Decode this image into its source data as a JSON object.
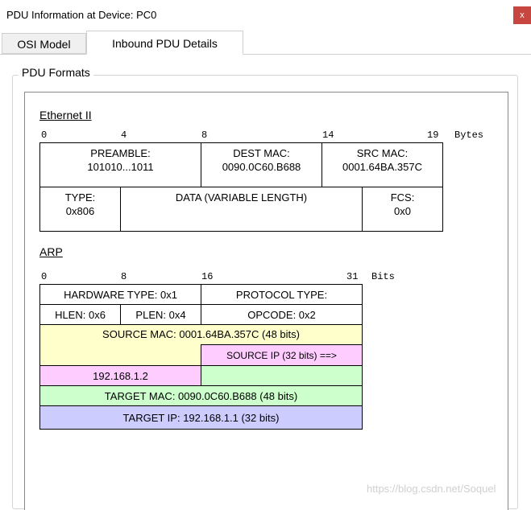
{
  "window": {
    "title": "PDU Information at Device: PC0",
    "close_label": "x"
  },
  "tabs": [
    {
      "label": "OSI Model"
    },
    {
      "label": "Inbound PDU Details"
    }
  ],
  "group": {
    "label": "PDU Formats"
  },
  "ethernet": {
    "title": "Ethernet II",
    "ruler": [
      "0",
      "4",
      "8",
      "14",
      "19",
      "Bytes"
    ],
    "preamble": {
      "label": "PREAMBLE:",
      "value": "101010...1011"
    },
    "dest_mac": {
      "label": "DEST MAC:",
      "value": "0090.0C60.B688"
    },
    "src_mac": {
      "label": "SRC MAC:",
      "value": "0001.64BA.357C"
    },
    "type": {
      "label": "TYPE:",
      "value": "0x806"
    },
    "data": {
      "label": "DATA (VARIABLE LENGTH)"
    },
    "fcs": {
      "label": "FCS:",
      "value": "0x0"
    }
  },
  "arp": {
    "title": "ARP",
    "ruler": [
      "0",
      "8",
      "16",
      "31",
      "Bits"
    ],
    "hardware_type": "HARDWARE TYPE: 0x1",
    "protocol_type": "PROTOCOL TYPE:",
    "hlen": "HLEN: 0x6",
    "plen": "PLEN: 0x4",
    "opcode": "OPCODE: 0x2",
    "source_mac": "SOURCE MAC: 0001.64BA.357C (48 bits)",
    "source_ip": "SOURCE IP (32 bits) ==>",
    "source_ip_value": "192.168.1.2",
    "target_mac": "TARGET MAC: 0090.0C60.B688 (48 bits)",
    "target_ip": "TARGET IP: 192.168.1.1 (32 bits)"
  },
  "colors": {
    "close_button": "#c7463f",
    "yellow": "#ffffcc",
    "pink": "#ffccff",
    "green": "#ccffcc",
    "blue": "#ccccff"
  },
  "watermark": "https://blog.csdn.net/Soquel"
}
